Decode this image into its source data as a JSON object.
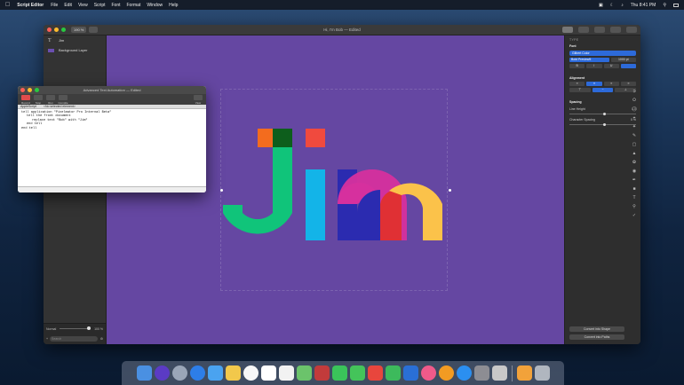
{
  "menubar": {
    "apple": "",
    "app": "Script Editor",
    "items": [
      "File",
      "Edit",
      "View",
      "Script",
      "Font",
      "Format",
      "Window",
      "Help"
    ],
    "clock": "Thu 8:41 PM"
  },
  "main_window": {
    "title": "Hi, I'm Bob — Edited",
    "zoom": "190 %",
    "layers": [
      {
        "name": "Jim",
        "type": "text"
      },
      {
        "name": "Background Layer",
        "type": "fill"
      }
    ],
    "footer": {
      "blend_mode": "Normal",
      "opacity": "100 %",
      "search_placeholder": "Search"
    },
    "canvas_text": "Jim",
    "canvas_bg": "#6547a2"
  },
  "inspector": {
    "section_type": "TYPE",
    "font_label": "Font",
    "font_name": "Gilbert Color",
    "font_style": "Bold Preview5",
    "font_size": "1000 pt",
    "style_buttons": [
      "B",
      "I",
      "U"
    ],
    "alignment_label": "Alignment",
    "spacing_label": "Spacing",
    "line_height_label": "Line Height",
    "line_height_value": "1.0",
    "char_spacing_label": "Character Spacing",
    "char_spacing_value": "0 %",
    "convert_shape": "Convert into Shape",
    "convert_paths": "Convert into Paths"
  },
  "script_window": {
    "title": "Advanced Text Automation — Edited",
    "tools": [
      "Record",
      "Stop",
      "Run",
      "Compile"
    ],
    "view_label": "View",
    "nav": [
      "AppleScript",
      "<No selected element>"
    ],
    "code": [
      "tell application \"Pixelmator Pro Internal Beta\"",
      "tell the front document",
      "replace text \"Bob\" with \"Jim\"",
      "end tell",
      "end tell"
    ]
  },
  "dock": {
    "apps": [
      "Finder",
      "Siri",
      "Launchpad",
      "Safari",
      "Mail",
      "Notes",
      "Photos",
      "Calendar",
      "Reminders",
      "Maps",
      "Photo Booth",
      "Messages",
      "FaceTime",
      "News",
      "Numbers",
      "Keynote",
      "iTunes",
      "iBooks",
      "App Store",
      "System Preferences",
      "Script Editor",
      "Pixelmator Pro",
      "Trash"
    ],
    "colors": [
      "#4a90e2",
      "#5b3bc4",
      "#9aa6b8",
      "#2d7ee8",
      "#4aa3f0",
      "#f2c84b",
      "#f7f7f7",
      "#ffffff",
      "#f2f2f2",
      "#6bc36b",
      "#c23b3b",
      "#3ac45a",
      "#44c45a",
      "#e8463d",
      "#3dba5c",
      "#2a6fd6",
      "#f05a8a",
      "#f29b22",
      "#2b8ff0",
      "#8d8d93",
      "#c8c8c8",
      "#f2a23a",
      "#b0b6bf"
    ]
  },
  "jim_colors": {
    "j_stem": "#10c47a",
    "j_top_orange": "#f36c1e",
    "j_top_dark": "#0d5e1c",
    "dot": "#f04a3e",
    "i_stem": "#13b4e8",
    "m_blue": "#2b2bb0",
    "m_pink": "#d6309e",
    "m_red": "#e03034",
    "m_yellow": "#fbc24a"
  }
}
